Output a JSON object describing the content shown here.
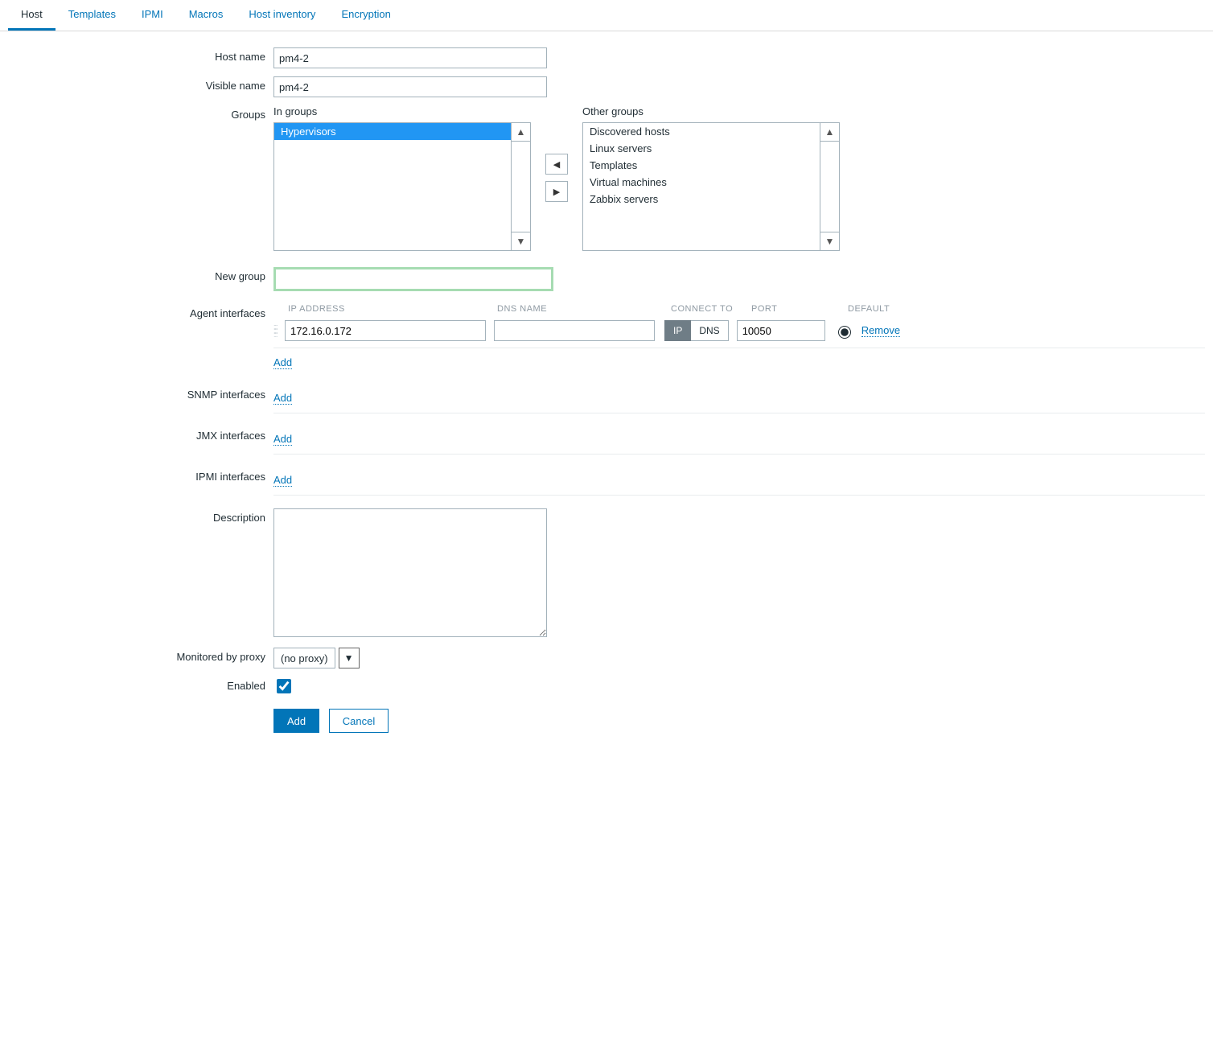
{
  "tabs": [
    "Host",
    "Templates",
    "IPMI",
    "Macros",
    "Host inventory",
    "Encryption"
  ],
  "active_tab_index": 0,
  "labels": {
    "host_name": "Host name",
    "visible_name": "Visible name",
    "groups": "Groups",
    "in_groups": "In groups",
    "other_groups": "Other groups",
    "new_group": "New group",
    "agent_interfaces": "Agent interfaces",
    "snmp_interfaces": "SNMP interfaces",
    "jmx_interfaces": "JMX interfaces",
    "ipmi_interfaces": "IPMI interfaces",
    "description": "Description",
    "monitored_by_proxy": "Monitored by proxy",
    "enabled": "Enabled"
  },
  "values": {
    "host_name": "pm4-2",
    "visible_name": "pm4-2",
    "new_group": "",
    "description": "",
    "proxy": "(no proxy)",
    "enabled": true
  },
  "groups": {
    "in": [
      "Hypervisors"
    ],
    "in_selected_index": 0,
    "other": [
      "Discovered hosts",
      "Linux servers",
      "Templates",
      "Virtual machines",
      "Zabbix servers"
    ]
  },
  "iface_headers": {
    "ip": "IP ADDRESS",
    "dns": "DNS NAME",
    "connect_to": "CONNECT TO",
    "port": "PORT",
    "default": "DEFAULT"
  },
  "agent_interfaces": [
    {
      "ip": "172.16.0.172",
      "dns": "",
      "connect_to": "IP",
      "port": "10050",
      "default": true
    }
  ],
  "connect_options": {
    "ip": "IP",
    "dns": "DNS"
  },
  "links": {
    "add": "Add",
    "remove": "Remove"
  },
  "buttons": {
    "add": "Add",
    "cancel": "Cancel"
  }
}
